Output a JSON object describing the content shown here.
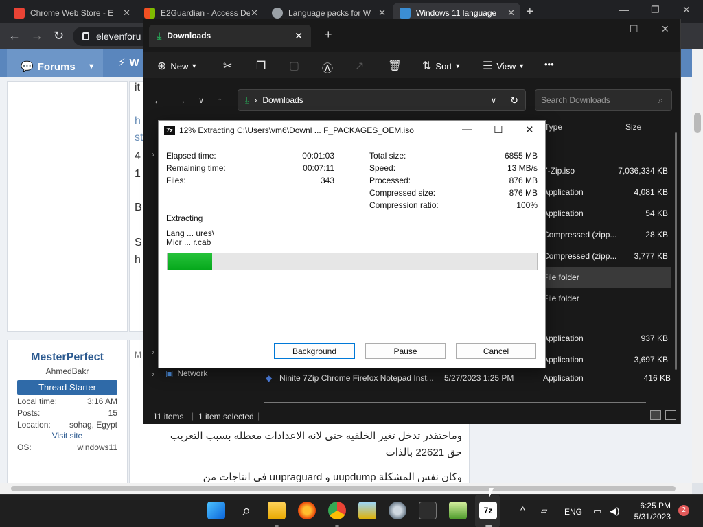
{
  "browser": {
    "tabs": [
      {
        "title": "Chrome Web Store - E",
        "favicon_color": "#ea4335"
      },
      {
        "title": "E2Guardian - Access De",
        "favicon_color": "#4285f4"
      },
      {
        "title": "Language packs for W",
        "favicon_color": "#9aa0a6"
      },
      {
        "title": "Windows 11 language",
        "favicon_color": "#3b8ed4",
        "active": true
      }
    ],
    "new_tab": "+",
    "url": "elevenforu",
    "controls": {
      "minimize": "—",
      "maximize": "❐",
      "close": "✕"
    }
  },
  "forum": {
    "nav": {
      "forums_label": "Forums",
      "next_label": "W"
    },
    "fragments": [
      "it",
      "h",
      "st",
      "4",
      "1",
      "B",
      "S",
      "h"
    ],
    "user": {
      "name": "MesterPerfect",
      "real_name": "AhmedBakr",
      "badge": "Thread Starter",
      "local_time_label": "Local time:",
      "local_time": "3:16 AM",
      "posts_label": "Posts:",
      "posts": "15",
      "location_label": "Location:",
      "location": "sohag, Egypt",
      "visit_site": "Visit site",
      "os_label": "OS:",
      "os": "windows11"
    },
    "post_marker": "M",
    "arabic_line1": "وماحتقدر تدخل تغير الخلفيه حتى لانه الاعدادات معطله بسبب التعريب",
    "arabic_line2": "حق 22621 بالذات",
    "arabic_line3": "وكان نفس المشكلة uupdump و uupraguard في انتاجات من"
  },
  "explorer": {
    "tab_title": "Downloads",
    "new_tab": "+",
    "controls": {
      "minimize": "—",
      "maximize": "☐",
      "close": "✕"
    },
    "commands": {
      "new": "New",
      "sort": "Sort",
      "view": "View",
      "more": "•••"
    },
    "path": "Downloads",
    "search_placeholder": "Search Downloads",
    "columns": {
      "type": "Type",
      "size": "Size"
    },
    "rows": [
      {
        "type": "7-Zip.iso",
        "size": "7,036,334 KB"
      },
      {
        "type": "Application",
        "size": "4,081 KB"
      },
      {
        "type": "Application",
        "size": "54 KB"
      },
      {
        "type": "Compressed (zipp...",
        "size": "28 KB"
      },
      {
        "type": "Compressed (zipp...",
        "size": "3,777 KB"
      },
      {
        "type": "File folder",
        "size": "",
        "selected": true
      },
      {
        "type": "File folder",
        "size": ""
      },
      {
        "type": "Application",
        "size": "937 KB"
      },
      {
        "type": "Application",
        "size": "3,697 KB"
      }
    ],
    "last_row": {
      "name": "Ninite 7Zip Chrome Firefox Notepad Inst...",
      "date": "5/27/2023 1:25 PM",
      "type": "Application",
      "size": "416 KB"
    },
    "nav_network": "Network",
    "status": {
      "items": "11 items",
      "selected": "1 item selected"
    }
  },
  "zip": {
    "title": "12% Extracting C:\\Users\\vm6\\Downl ... F_PACKAGES_OEM.iso",
    "percent": 12,
    "elapsed_label": "Elapsed time:",
    "elapsed": "00:01:03",
    "remaining_label": "Remaining time:",
    "remaining": "00:07:11",
    "files_label": "Files:",
    "files": "343",
    "total_label": "Total size:",
    "total": "6855 MB",
    "speed_label": "Speed:",
    "speed": "13 MB/s",
    "processed_label": "Processed:",
    "processed": "876 MB",
    "compressed_label": "Compressed size:",
    "compressed": "876 MB",
    "ratio_label": "Compression ratio:",
    "ratio": "100%",
    "status": "Extracting",
    "file_line1": "Lang ... ures\\",
    "file_line2": "Micr ... r.cab",
    "buttons": {
      "background": "Background",
      "pause": "Pause",
      "cancel": "Cancel"
    }
  },
  "taskbar": {
    "language": "ENG",
    "time": "6:25 PM",
    "date": "5/31/2023",
    "notifications": "2",
    "chevron": "^"
  },
  "colors": {
    "accent": "#0078d7",
    "progress": "#06b025",
    "explorer_bg": "#191919"
  }
}
